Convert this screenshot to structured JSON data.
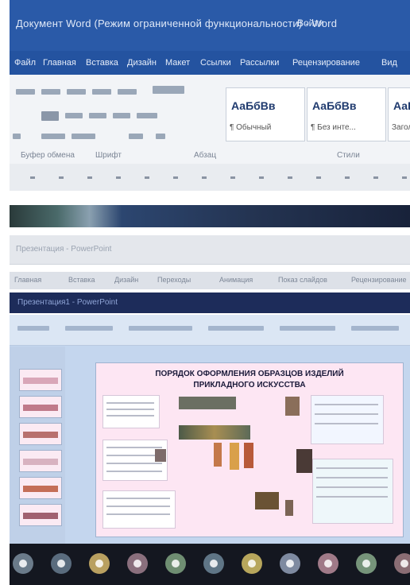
{
  "word": {
    "title": "Документ Word (Режим ограниченной функциональности) - Word",
    "title_right": "Войти",
    "tabs": [
      "Файл",
      "Главная",
      "Вставка",
      "Дизайн",
      "Макет",
      "Ссылки",
      "Рассылки",
      "Рецензирование",
      "Вид"
    ],
    "styles": [
      {
        "sample": "АаБбВв",
        "caption": "¶ Обычный"
      },
      {
        "sample": "АаБбВв",
        "caption": "¶ Без инте..."
      },
      {
        "sample": "АаБ",
        "caption": "Заголо..."
      }
    ],
    "group_labels": [
      "Буфер обмена",
      "Шрифт",
      "Абзац",
      "Стили"
    ]
  },
  "window2": {
    "toolbar_label": "Презентация - PowerPoint",
    "tabs": [
      "Главная",
      "Вставка",
      "Дизайн",
      "Переходы",
      "Анимация",
      "Показ слайдов",
      "Рецензирование"
    ],
    "title": "Презентация1 - PowerPoint"
  },
  "slide": {
    "title_line1": "ПОРЯДОК ОФОРМЛЕНИЯ ОБРАЗЦОВ ИЗДЕЛИЙ",
    "title_line2": "ПРИКЛАДНОГО ИСКУССТВА"
  },
  "colors": {
    "word_accent": "#2a5aa8",
    "slide_bg": "#fde6f3",
    "taskbar": "#141720"
  },
  "taskbar_icons": [
    "participant-icon-1",
    "participant-icon-2",
    "participant-icon-3",
    "participant-icon-4",
    "participant-icon-5",
    "participant-icon-6",
    "participant-icon-7",
    "participant-icon-8",
    "participant-icon-9",
    "participant-icon-10",
    "participant-icon-11"
  ]
}
